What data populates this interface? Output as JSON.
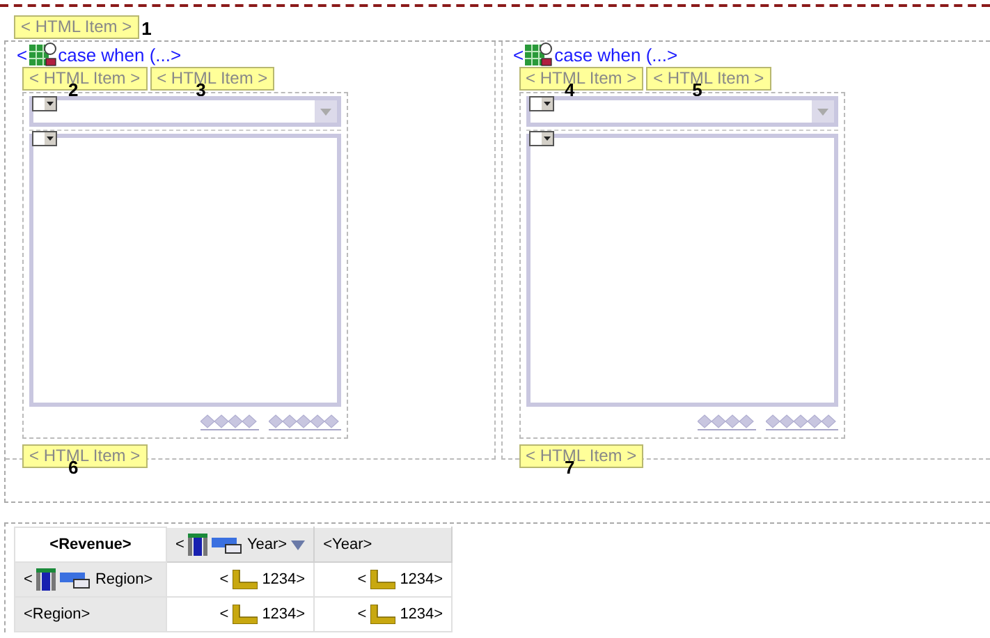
{
  "top_item": {
    "label": "< HTML Item >",
    "callout": "1"
  },
  "blocks": [
    {
      "prefix": "<",
      "condition": "case when (...>",
      "items": [
        {
          "label": "< HTML Item >",
          "callout": "2"
        },
        {
          "label": "< HTML Item >",
          "callout": "3"
        }
      ],
      "footer": {
        "label": "< HTML Item >",
        "callout": "6"
      }
    },
    {
      "prefix": "<",
      "condition": "case when (...>",
      "items": [
        {
          "label": "< HTML Item >",
          "callout": "4"
        },
        {
          "label": "< HTML Item >",
          "callout": "5"
        }
      ],
      "footer": {
        "label": "< HTML Item >",
        "callout": "7"
      }
    }
  ],
  "crosstab": {
    "corner": "<Revenue>",
    "columns": [
      {
        "kind": "member",
        "prefix": "<",
        "label": "Year>"
      },
      {
        "kind": "plain",
        "label": "<Year>"
      }
    ],
    "rows": [
      {
        "header": {
          "kind": "member",
          "prefix": "<",
          "label": "Region>"
        },
        "cells": [
          {
            "prefix": "<",
            "value": "1234>"
          },
          {
            "prefix": "<",
            "value": "1234>"
          }
        ]
      },
      {
        "header": {
          "kind": "plain",
          "label": "<Region>"
        },
        "cells": [
          {
            "prefix": "<",
            "value": "1234>"
          },
          {
            "prefix": "<",
            "value": "1234>"
          }
        ]
      }
    ]
  }
}
